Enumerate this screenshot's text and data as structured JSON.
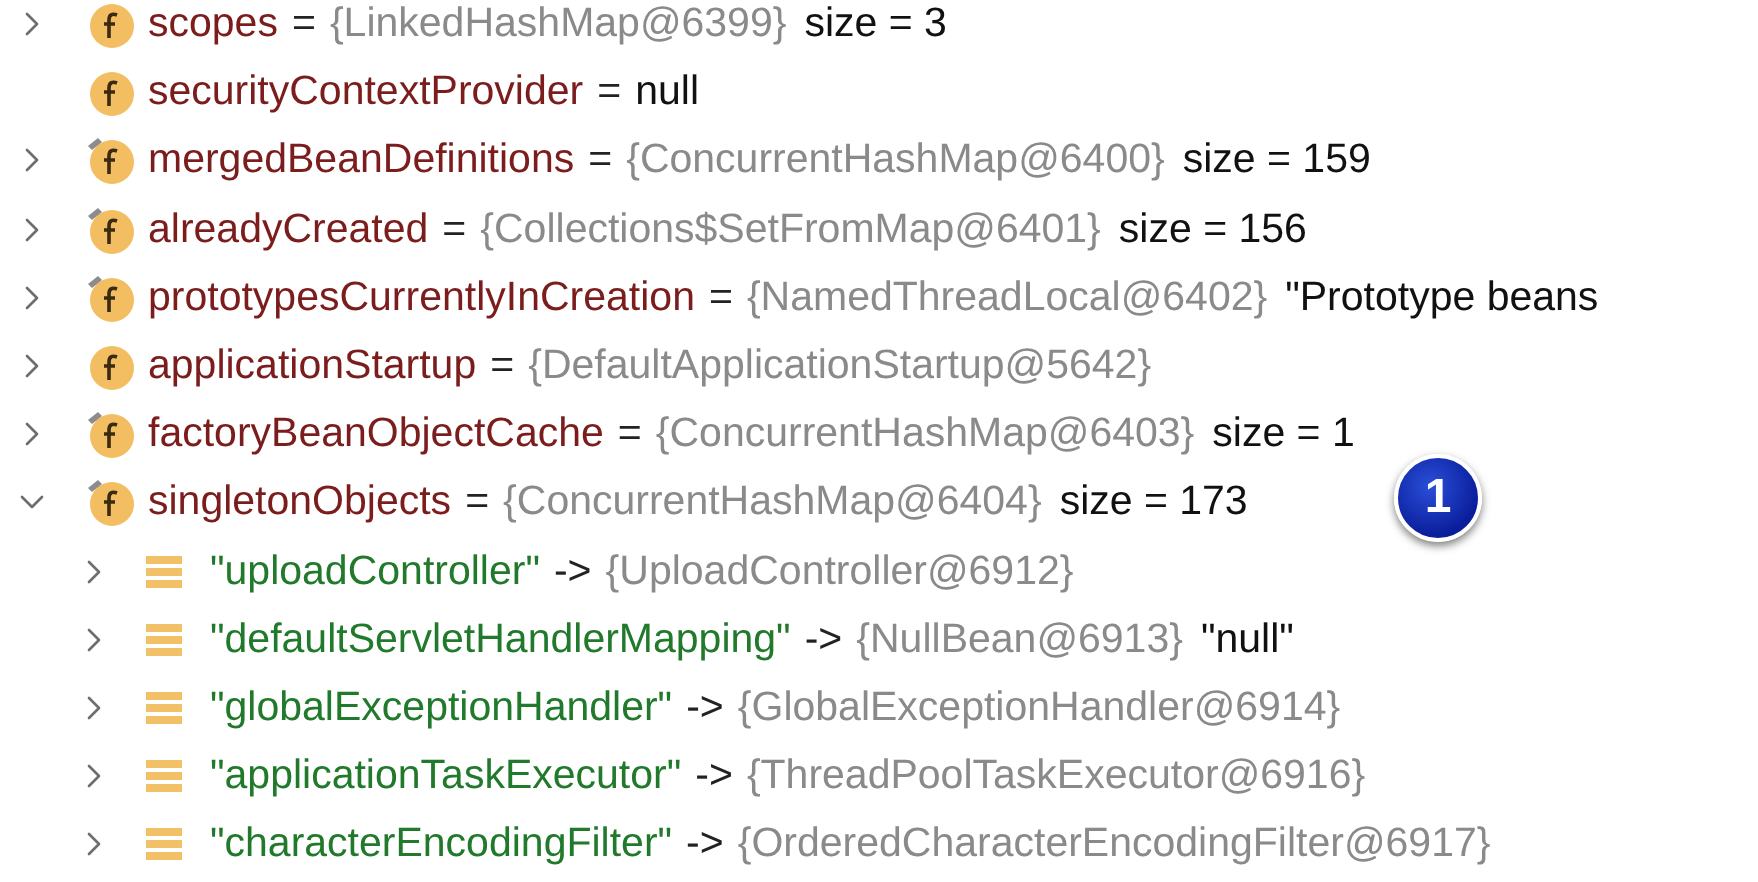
{
  "variables": [
    {
      "kind": "field",
      "final": false,
      "expandable": true,
      "expanded": false,
      "name": "scopes",
      "separator": "=",
      "value": "{LinkedHashMap@6399}",
      "detail": "size = 3"
    },
    {
      "kind": "field",
      "final": false,
      "expandable": false,
      "name": "securityContextProvider",
      "separator": "=",
      "detail": "null"
    },
    {
      "kind": "field",
      "final": true,
      "expandable": true,
      "expanded": false,
      "name": "mergedBeanDefinitions",
      "separator": "=",
      "value": "{ConcurrentHashMap@6400}",
      "detail": "size = 159"
    },
    {
      "kind": "field",
      "final": true,
      "expandable": true,
      "expanded": false,
      "name": "alreadyCreated",
      "separator": "=",
      "value": "{Collections$SetFromMap@6401}",
      "detail": "size = 156"
    },
    {
      "kind": "field",
      "final": true,
      "expandable": true,
      "expanded": false,
      "name": "prototypesCurrentlyInCreation",
      "separator": "=",
      "value": "{NamedThreadLocal@6402}",
      "detail": "\"Prototype beans"
    },
    {
      "kind": "field",
      "final": false,
      "expandable": true,
      "expanded": false,
      "name": "applicationStartup",
      "separator": "=",
      "value": "{DefaultApplicationStartup@5642}"
    },
    {
      "kind": "field",
      "final": true,
      "expandable": true,
      "expanded": false,
      "name": "factoryBeanObjectCache",
      "separator": "=",
      "value": "{ConcurrentHashMap@6403}",
      "detail": "size = 1"
    },
    {
      "kind": "field",
      "final": true,
      "expandable": true,
      "expanded": true,
      "name": "singletonObjects",
      "separator": "=",
      "value": "{ConcurrentHashMap@6404}",
      "detail": "size = 173",
      "callout": "1",
      "children": [
        {
          "kind": "entry",
          "expandable": true,
          "expanded": false,
          "name": "\"uploadController\"",
          "separator": "->",
          "value": "{UploadController@6912}"
        },
        {
          "kind": "entry",
          "expandable": true,
          "expanded": false,
          "name": "\"defaultServletHandlerMapping\"",
          "separator": "->",
          "value": "{NullBean@6913}",
          "detail": "\"null\""
        },
        {
          "kind": "entry",
          "expandable": true,
          "expanded": false,
          "name": "\"globalExceptionHandler\"",
          "separator": "->",
          "value": "{GlobalExceptionHandler@6914}"
        },
        {
          "kind": "entry",
          "expandable": true,
          "expanded": false,
          "name": "\"applicationTaskExecutor\"",
          "separator": "->",
          "value": "{ThreadPoolTaskExecutor@6916}"
        },
        {
          "kind": "entry",
          "expandable": true,
          "expanded": false,
          "name": "\"characterEncodingFilter\"",
          "separator": "->",
          "value": "{OrderedCharacterEncodingFilter@6917}"
        }
      ]
    }
  ]
}
